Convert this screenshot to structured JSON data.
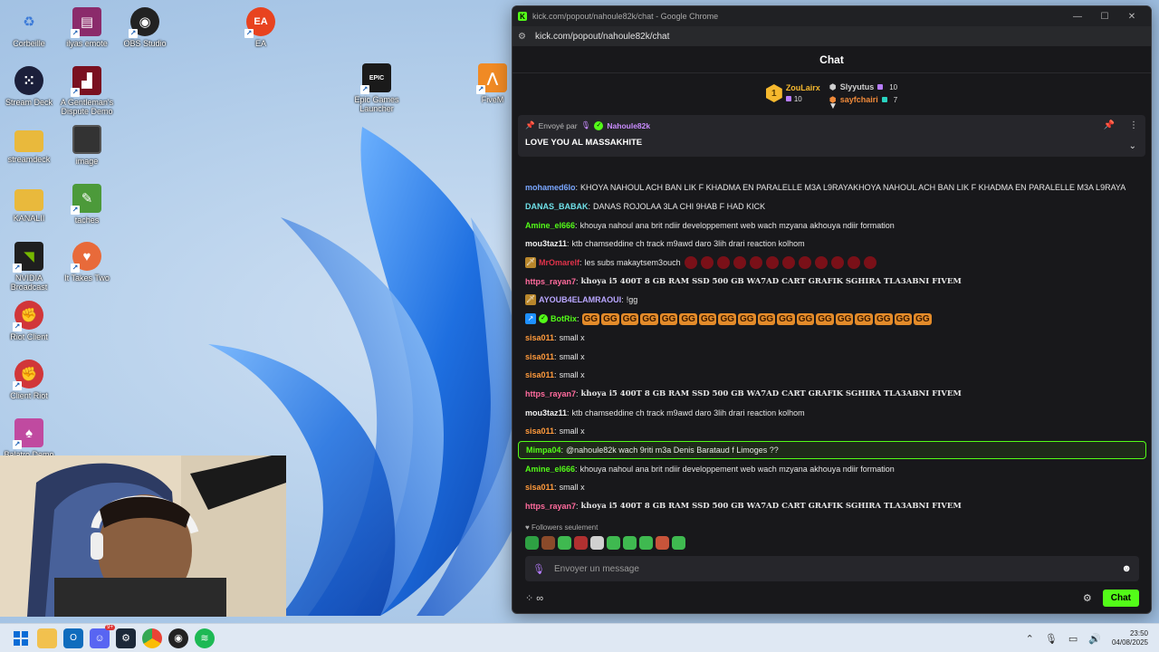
{
  "desktop": {
    "icons": [
      {
        "label": "Corbeille",
        "icon": "recycle-bin-icon",
        "color": "#6aa7e0"
      },
      {
        "label": "ilyas emote",
        "icon": "winrar-icon",
        "color": "#8b2b6b"
      },
      {
        "label": "OBS Studio",
        "icon": "obs-icon",
        "color": "#222222"
      },
      {
        "label": "EA",
        "icon": "ea-icon",
        "color": "#e8431f"
      },
      {
        "label": "Stream Deck",
        "icon": "stream-deck-icon",
        "color": "#1b1f3a"
      },
      {
        "label": "A Gentleman's Dispute Demo",
        "icon": "top-hat-icon",
        "color": "#7a1020"
      },
      {
        "label": "Epic Games Launcher",
        "icon": "epic-games-icon",
        "color": "#1a1a1a"
      },
      {
        "label": "FiveM",
        "icon": "fivem-icon",
        "color": "#f08a24"
      },
      {
        "label": "streamdeck",
        "icon": "folder-icon",
        "color": "#e9b93c"
      },
      {
        "label": "image",
        "icon": "image-file-icon",
        "color": "#333333"
      },
      {
        "label": "KANALII",
        "icon": "folder-icon",
        "color": "#e9b93c"
      },
      {
        "label": "taches",
        "icon": "notepad-icon",
        "color": "#4c9a3a"
      },
      {
        "label": "NVIDIA Broadcast",
        "icon": "nvidia-icon",
        "color": "#1f1f1f"
      },
      {
        "label": "It Takes Two",
        "icon": "it-takes-two-icon",
        "color": "#e86a3a"
      },
      {
        "label": "Riot Client",
        "icon": "riot-icon",
        "color": "#d13639"
      },
      {
        "label": "Client Riot",
        "icon": "riot-icon",
        "color": "#d13639"
      },
      {
        "label": "Balatro Demo",
        "icon": "balatro-icon",
        "color": "#c04aa0"
      }
    ]
  },
  "window": {
    "title": "kick.com/popout/nahoule82k/chat - Google Chrome",
    "url": "kick.com/popout/nahoule82k/chat",
    "controls": {
      "minimize": "—",
      "maximize": "☐",
      "close": "✕"
    }
  },
  "chat": {
    "header": "Chat",
    "leaderboard": {
      "first": {
        "rank": "1",
        "name": "ZouLairx",
        "count": "10",
        "color": "#f5b82e"
      },
      "second": {
        "name": "Slyyutus",
        "count": "10",
        "color": "#cfcfcf"
      },
      "third": {
        "name": "sayfchairi",
        "count": "7",
        "color": "#f08a3a"
      }
    },
    "pinned": {
      "prefix": "Envoyé par",
      "sender": "Nahoule82k",
      "message": "LOVE YOU AL MASSAKHITE"
    },
    "messages": [
      {
        "user": "mohamed6lo",
        "color": "#7aa7ff",
        "text": "KHOYA NAHOUL ACH BAN LIK F KHADMA EN PARALELLE M3A L9RAYAKHOYA NAHOUL ACH BAN LIK F KHADMA EN PARALELLE M3A L9RAYA",
        "style": "normal"
      },
      {
        "user": "DANAS_BABAK",
        "color": "#6fe0e8",
        "text": "DANAS ROJOLAA 3LA CHI 9HAB F HAD KICK",
        "style": "normal"
      },
      {
        "user": "Amine_el666",
        "color": "#53fc18",
        "text": "khouya nahoul ana brit ndiir developpement web wach mzyana akhouya ndiir formation",
        "style": "normal"
      },
      {
        "user": "mou3taz11",
        "color": "#f0f0f0",
        "text": "ktb chamseddine ch track m9awd daro 3lih drari reaction kolhom",
        "style": "normal"
      },
      {
        "user": "MrOmarelf",
        "color": "#e0324a",
        "text": "les subs makaytsem3ouch",
        "style": "emotes",
        "badge": "🗡"
      },
      {
        "user": "https_rayan7",
        "color": "#ff6b9d",
        "text": "khoya i5 400T 8 GB RAM SSD 500 GB WA7AD CART GRAFIK SGHIRA TLA3ABNI FIVEM",
        "style": "serif"
      },
      {
        "user": "AYOUB4ELAMRAOUI",
        "color": "#b9a6ff",
        "text": "!gg",
        "style": "normal",
        "badge": "🗡"
      },
      {
        "user": "BotRix",
        "color": "#53fc18",
        "text": "GG GG GG GG GG GG GG GG GG GG GG GG GG GG GG GG GG GG",
        "style": "gg",
        "badge": "↗"
      },
      {
        "user": "sisa011",
        "color": "#ff9a3c",
        "text": "small x",
        "style": "normal"
      },
      {
        "user": "sisa011",
        "color": "#ff9a3c",
        "text": "small x",
        "style": "normal"
      },
      {
        "user": "sisa011",
        "color": "#ff9a3c",
        "text": "small x",
        "style": "normal"
      },
      {
        "user": "https_rayan7",
        "color": "#ff6b9d",
        "text": "khoya i5 400T 8 GB RAM SSD 500 GB WA7AD CART GRAFIK SGHIRA TLA3ABNI FIVEM",
        "style": "serif"
      },
      {
        "user": "mou3taz11",
        "color": "#f0f0f0",
        "text": "ktb chamseddine ch track m9awd daro 3lih drari reaction kolhom",
        "style": "normal"
      },
      {
        "user": "sisa011",
        "color": "#ff9a3c",
        "text": "small x",
        "style": "normal"
      },
      {
        "user": "Mimpa04",
        "color": "#53fc18",
        "text": "@nahoule82k wach 9riti m3a Denis Barataud f Limoges ??",
        "style": "mention"
      },
      {
        "user": "Amine_el666",
        "color": "#53fc18",
        "text": "khouya nahoul ana brit ndiir developpement web wach mzyana akhouya ndiir formation",
        "style": "normal"
      },
      {
        "user": "sisa011",
        "color": "#ff9a3c",
        "text": "small x",
        "style": "normal"
      },
      {
        "user": "https_rayan7",
        "color": "#ff6b9d",
        "text": "khoya i5 400T 8 GB RAM SSD 500 GB WA7AD CART GRAFIK SGHIRA TLA3ABNI FIVEM",
        "style": "serif"
      }
    ],
    "followers_only": "Followers seulement",
    "input_placeholder": "Envoyer un message",
    "send_label": "Chat"
  },
  "taskbar": {
    "time": "23:50",
    "date": "04/08/2025",
    "discord_badge": "9+"
  },
  "colors": {
    "kick_green": "#53fc18",
    "chat_bg": "#18181b"
  }
}
